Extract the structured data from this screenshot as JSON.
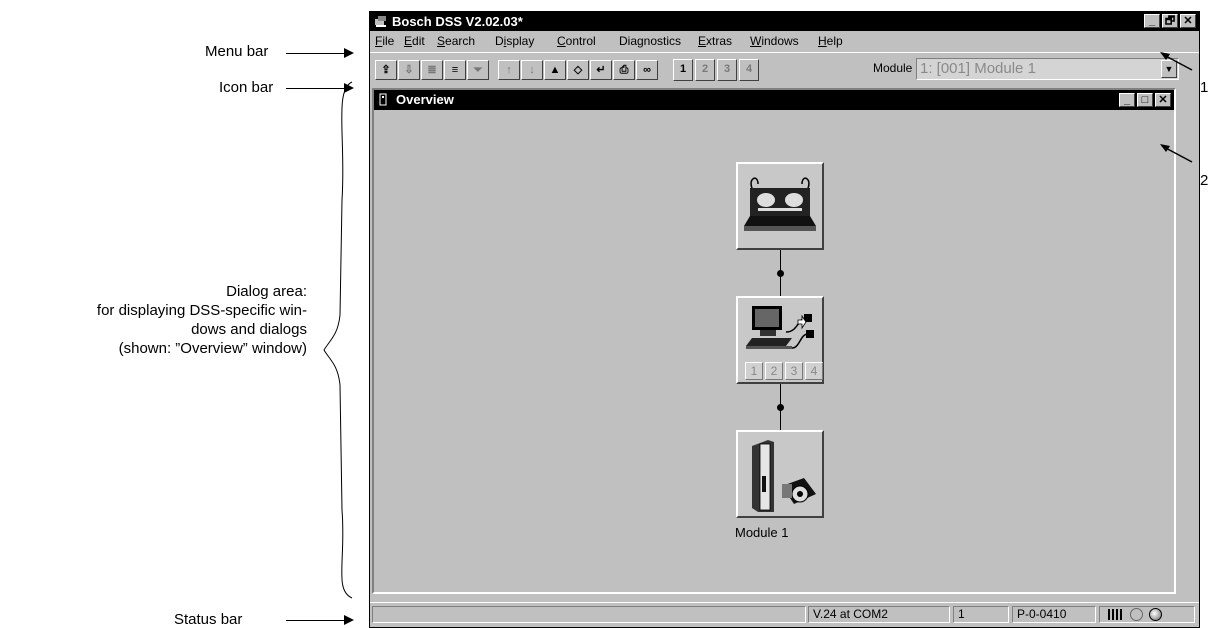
{
  "annotations": {
    "menu_bar": "Menu bar",
    "icon_bar": "Icon bar",
    "dialog_area": [
      "Dialog area:",
      "for displaying DSS-specific win-",
      "dows and dialogs",
      "(shown: ”Overview” window)"
    ],
    "status_bar": "Status bar",
    "callout_1": "1",
    "callout_2": "2"
  },
  "window": {
    "title": "Bosch DSS V2.02.03*",
    "controls": [
      "_",
      "🗗",
      "✕"
    ]
  },
  "menu": [
    {
      "pre": "",
      "u": "F",
      "post": "ile"
    },
    {
      "pre": "",
      "u": "E",
      "post": "dit"
    },
    {
      "pre": "",
      "u": "S",
      "post": "earch"
    },
    {
      "pre": "D",
      "u": "i",
      "post": "splay"
    },
    {
      "pre": "",
      "u": "C",
      "post": "ontrol"
    },
    {
      "pre": "Diagnostics",
      "u": "",
      "post": ""
    },
    {
      "pre": "",
      "u": "E",
      "post": "xtras"
    },
    {
      "pre": "",
      "u": "W",
      "post": "indows"
    },
    {
      "pre": "",
      "u": "H",
      "post": "elp"
    }
  ],
  "toolbar": {
    "slots": [
      "1",
      "2",
      "3",
      "4"
    ],
    "module_label": "Module",
    "module_value": "1: [001] Module 1"
  },
  "overview": {
    "title": "Overview",
    "controls": [
      "_",
      "□",
      "✕"
    ],
    "pc_slots": [
      "1",
      "2",
      "3",
      "4"
    ],
    "module_caption": "Module 1"
  },
  "status": {
    "port": "V.24 at COM2",
    "index": "1",
    "param": "P-0-0410"
  }
}
